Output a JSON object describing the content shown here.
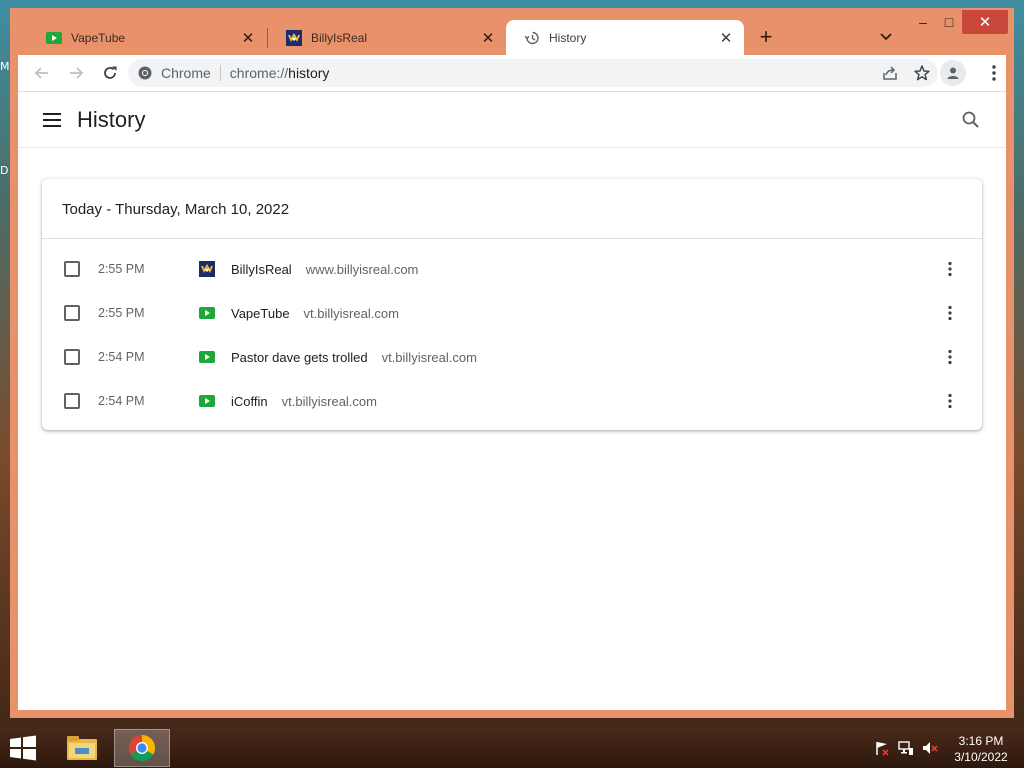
{
  "desktop": {
    "letters": [
      "M",
      "D"
    ]
  },
  "tabs": [
    {
      "label": "VapeTube",
      "favicon": "vapetube-favicon",
      "active": false
    },
    {
      "label": "BillyIsReal",
      "favicon": "billyisreal-favicon",
      "active": false
    },
    {
      "label": "History",
      "favicon": "history-icon",
      "active": true
    }
  ],
  "tab_close_glyph": "✕",
  "new_tab_glyph": "+",
  "window_controls": {
    "minimize": "–",
    "maximize": "□",
    "close": "✕"
  },
  "omnibox": {
    "site_label": "Chrome",
    "url_prefix": "chrome://",
    "url_path": "history"
  },
  "page": {
    "title": "History"
  },
  "history": {
    "date_header": "Today - Thursday, March 10, 2022",
    "entries": [
      {
        "time": "2:55 PM",
        "title": "BillyIsReal",
        "domain": "www.billyisreal.com",
        "favicon": "billyisreal-favicon"
      },
      {
        "time": "2:55 PM",
        "title": "VapeTube",
        "domain": "vt.billyisreal.com",
        "favicon": "vapetube-favicon"
      },
      {
        "time": "2:54 PM",
        "title": "Pastor dave gets trolled",
        "domain": "vt.billyisreal.com",
        "favicon": "vapetube-favicon"
      },
      {
        "time": "2:54 PM",
        "title": "iCoffin",
        "domain": "vt.billyisreal.com",
        "favicon": "vapetube-favicon"
      }
    ]
  },
  "taskbar": {
    "clock_time": "3:16 PM",
    "clock_date": "3/10/2022"
  },
  "colors": {
    "window_frame": "#e8916a",
    "close_button": "#c8463a",
    "vapetube_green": "#1fa83a",
    "billy_navy": "#1e2a6e"
  }
}
